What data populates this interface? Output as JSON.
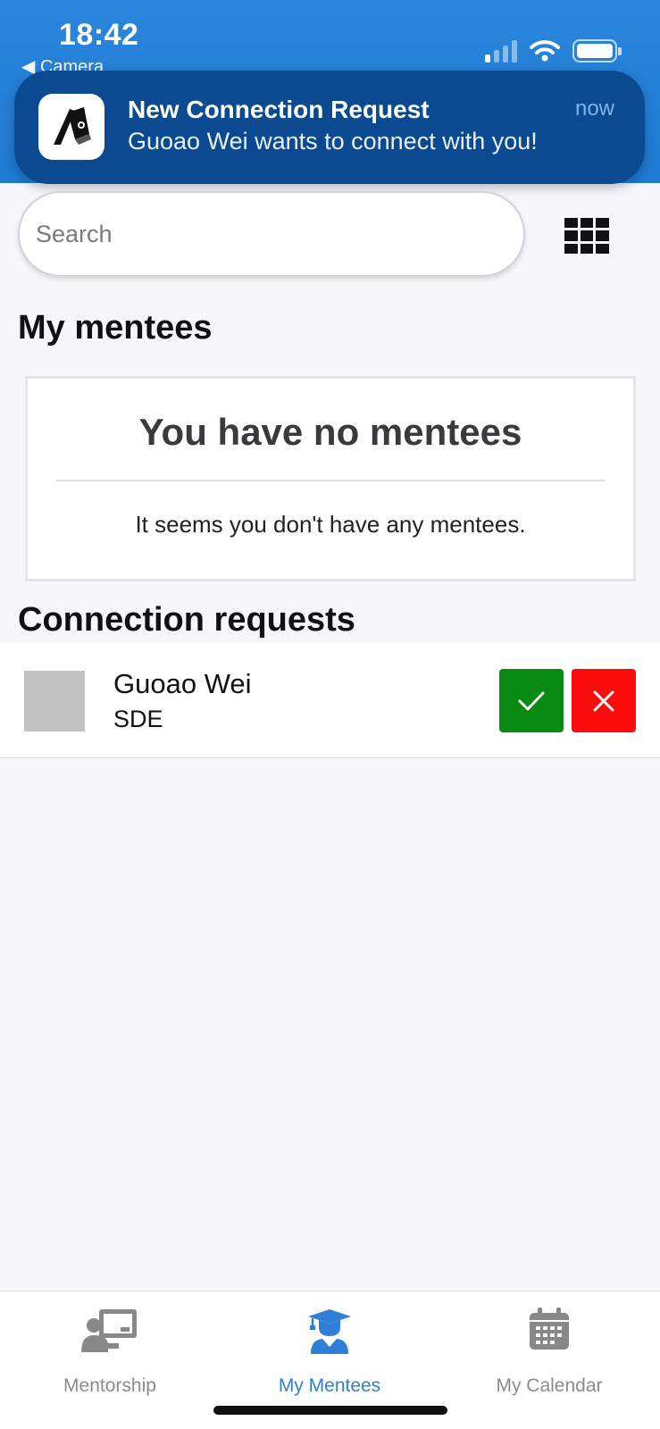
{
  "status_bar": {
    "time": "18:42",
    "back_app": "◀ Camera"
  },
  "notification": {
    "title": "New Connection Request",
    "body": "Guoao Wei wants to connect with you!",
    "time": "now"
  },
  "search": {
    "placeholder": "Search"
  },
  "mentees": {
    "heading": "My mentees",
    "empty_title": "You have no mentees",
    "empty_text": "It seems you don't have any mentees."
  },
  "requests": {
    "heading": "Connection requests",
    "items": [
      {
        "name": "Guoao Wei",
        "role": "SDE"
      }
    ]
  },
  "tabs": [
    {
      "label": "Mentorship",
      "icon": "mentorship-icon",
      "active": false
    },
    {
      "label": "My Mentees",
      "icon": "graduate-icon",
      "active": true
    },
    {
      "label": "My Calendar",
      "icon": "calendar-icon",
      "active": false
    }
  ],
  "colors": {
    "header_blue": "#1f7ad3",
    "notification_bg": "#0b4a90",
    "accept_green": "#078a0f",
    "reject_red": "#fb0b0b",
    "active_tab": "#2f7fd6",
    "inactive_tab": "#8c8c90"
  }
}
